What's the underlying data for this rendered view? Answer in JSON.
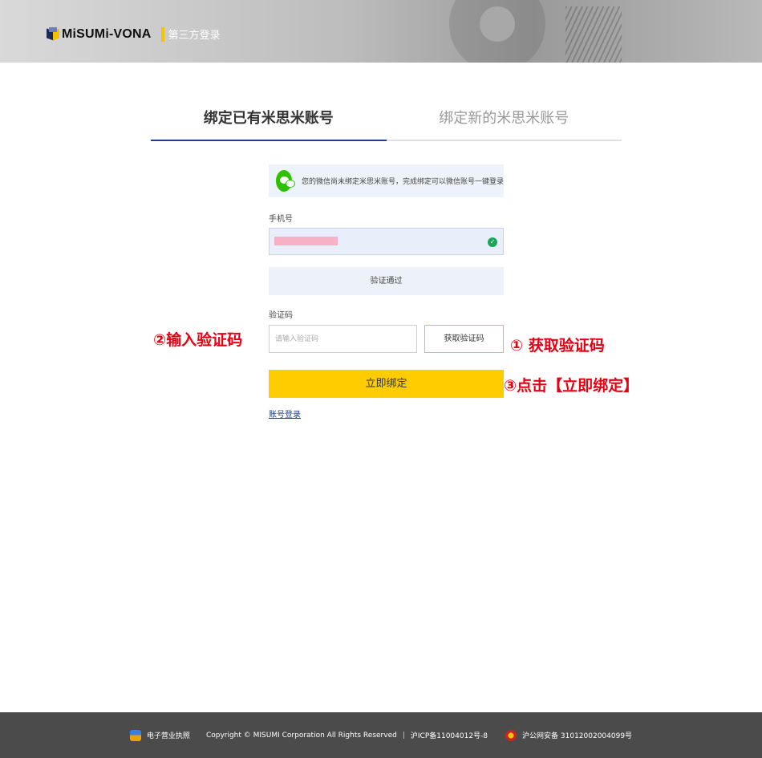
{
  "header": {
    "logo_text": "MiSUMi-VONA",
    "subtitle": "第三方登录"
  },
  "tabs": [
    {
      "label": "绑定已有米思米账号",
      "active": true
    },
    {
      "label": "绑定新的米思米账号",
      "active": false
    }
  ],
  "notice": {
    "icon": "wechat-icon",
    "text": "您的微信尚未绑定米思米账号，完成绑定可以微信账号一键登录"
  },
  "form": {
    "phone_label": "手机号",
    "phone_status": "verified",
    "verified_label": "验证通过",
    "code_label": "验证码",
    "code_placeholder": "请输入验证码",
    "get_code_label": "获取验证码",
    "bind_button": "立即绑定",
    "account_login_link": "账号登录"
  },
  "annotations": {
    "step1": "① 获取验证码",
    "step2": "②输入验证码",
    "step3": "③点击【立即绑定】",
    "color": "#e60012"
  },
  "footer": {
    "license": "电子营业执照",
    "copyright": "Copyright © MISUMI Corporation All Rights Reserved",
    "separator": "|",
    "icp": "沪ICP备11004012号-8",
    "police": "沪公网安备 31012002004099号"
  },
  "colors": {
    "accent_yellow": "#ffcc00",
    "tab_active": "#1d3f8c",
    "wechat_green": "#2dc100"
  }
}
